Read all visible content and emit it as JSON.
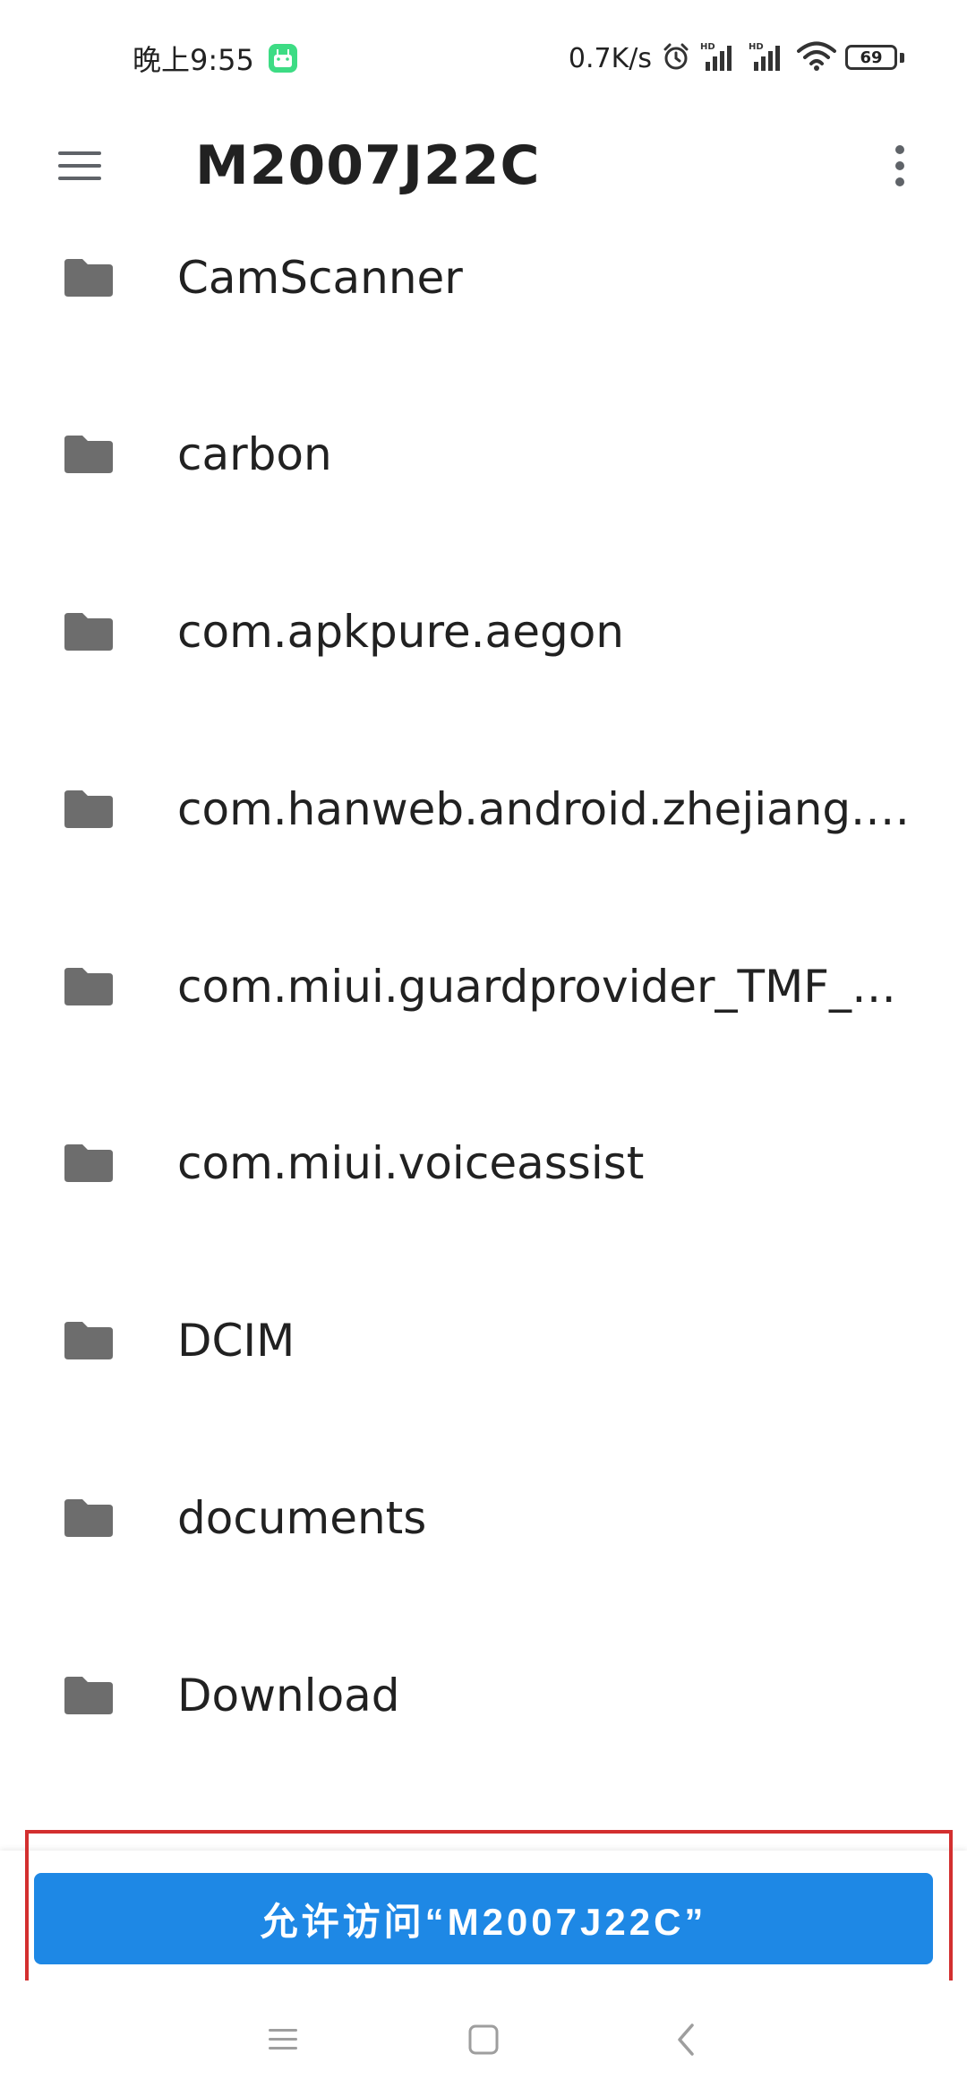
{
  "status_bar": {
    "time": "晚上9:55",
    "net_speed": "0.7K/s",
    "battery": "69",
    "icons": [
      "android-icon",
      "alarm-icon",
      "signal-hd-icon",
      "signal-hd-icon",
      "wifi-icon",
      "battery-icon"
    ]
  },
  "app_bar": {
    "title": "M2007J22C",
    "menu_icon": "hamburger-menu-icon",
    "more_icon": "more-vert-icon"
  },
  "folders": [
    {
      "name": "CamScanner"
    },
    {
      "name": "carbon"
    },
    {
      "name": "com.apkpure.aegon"
    },
    {
      "name": "com.hanweb.android.zhejiang.a..."
    },
    {
      "name": "com.miui.guardprovider_TMF_T..."
    },
    {
      "name": "com.miui.voiceassist"
    },
    {
      "name": "DCIM"
    },
    {
      "name": "documents"
    },
    {
      "name": "Download"
    }
  ],
  "allow_button": {
    "label": "允许访问“M2007J22C”"
  },
  "colors": {
    "accent": "#1e88e5",
    "highlight": "#d32f2f",
    "folder_icon": "#6d6d6d"
  },
  "nav_bar": {
    "icons": [
      "recents-icon",
      "home-icon",
      "back-icon"
    ]
  }
}
